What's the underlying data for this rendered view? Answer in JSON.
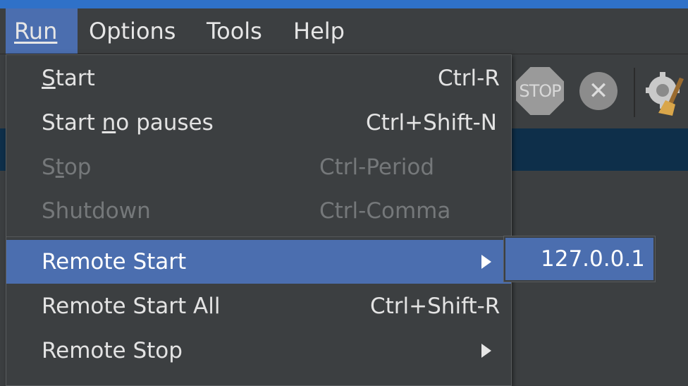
{
  "menubar": {
    "items": [
      {
        "label": "Run",
        "mnemonic_index": 0
      },
      {
        "label": "Options",
        "mnemonic_index": 0
      },
      {
        "label": "Tools",
        "mnemonic_index": 0
      },
      {
        "label": "Help",
        "mnemonic_index": 0
      }
    ]
  },
  "toolbar": {
    "stop_text": "STOP",
    "clear_glyph": "✕"
  },
  "run_menu": {
    "items": [
      {
        "label_pre": "",
        "mnemonic": "S",
        "label_post": "tart",
        "shortcut": "Ctrl-R",
        "enabled": true
      },
      {
        "label_pre": "Start ",
        "mnemonic": "n",
        "label_post": "o pauses",
        "shortcut": "Ctrl+Shift-N",
        "enabled": true
      },
      {
        "label_pre": "S",
        "mnemonic": "t",
        "label_post": "op",
        "shortcut": "Ctrl-Period",
        "enabled": false
      },
      {
        "label_pre": "Shutdown",
        "mnemonic": "",
        "label_post": "",
        "shortcut": "Ctrl-Comma",
        "enabled": false
      },
      {
        "label_pre": "Remote Start",
        "mnemonic": "",
        "label_post": "",
        "shortcut": "",
        "enabled": true,
        "submenu": true,
        "highlighted": true
      },
      {
        "label_pre": "Remote Start All",
        "mnemonic": "",
        "label_post": "",
        "shortcut": "Ctrl+Shift-R",
        "enabled": true
      },
      {
        "label_pre": "Remote Stop",
        "mnemonic": "",
        "label_post": "",
        "shortcut": "",
        "enabled": true,
        "submenu": true
      }
    ]
  },
  "remote_start_submenu": {
    "items": [
      {
        "label": "127.0.0.1"
      }
    ]
  },
  "colors": {
    "accent": "#4b6eaf",
    "menu_bg": "#3c3f41",
    "disabled_text": "#75787a",
    "title_strip": "#2f71c8"
  }
}
